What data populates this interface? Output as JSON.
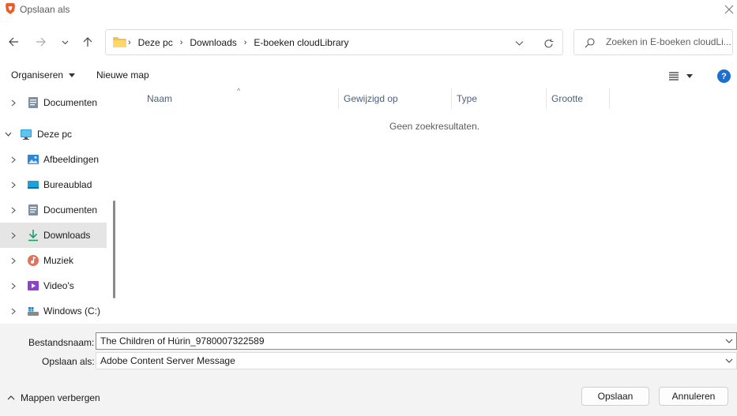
{
  "window": {
    "title": "Opslaan als"
  },
  "address": {
    "crumbs": [
      "Deze pc",
      "Downloads",
      "E-boeken cloudLibrary"
    ]
  },
  "search": {
    "placeholder": "Zoeken in E-boeken cloudLi..."
  },
  "toolbar": {
    "organize_label": "Organiseren",
    "new_folder_label": "Nieuwe map",
    "help_label": "?"
  },
  "sidebar": {
    "items": [
      {
        "label": "Documenten",
        "icon": "documents-icon"
      },
      {
        "label": "Deze pc",
        "icon": "monitor-icon"
      },
      {
        "label": "Afbeeldingen",
        "icon": "pictures-icon"
      },
      {
        "label": "Bureaublad",
        "icon": "desktop-icon"
      },
      {
        "label": "Documenten",
        "icon": "documents-icon"
      },
      {
        "label": "Downloads",
        "icon": "download-icon",
        "selected": true
      },
      {
        "label": "Muziek",
        "icon": "music-icon"
      },
      {
        "label": "Video's",
        "icon": "video-icon"
      },
      {
        "label": "Windows (C:)",
        "icon": "drive-icon"
      }
    ]
  },
  "list": {
    "columns": [
      "Naam",
      "Gewijzigd op",
      "Type",
      "Grootte"
    ],
    "empty_message": "Geen zoekresultaten."
  },
  "form": {
    "filename_label": "Bestandsnaam:",
    "filename_value": "The Children of Húrin_9780007322589",
    "saveas_label": "Opslaan als:",
    "saveas_value": "Adobe Content Server Message"
  },
  "footer": {
    "hide_folders_label": "Mappen verbergen",
    "save_label": "Opslaan",
    "cancel_label": "Annuleren"
  },
  "colors": {
    "accent": "#1a6fd1",
    "selected_bg": "#e5e5e5",
    "bottom_bg": "#f3f3f3"
  }
}
